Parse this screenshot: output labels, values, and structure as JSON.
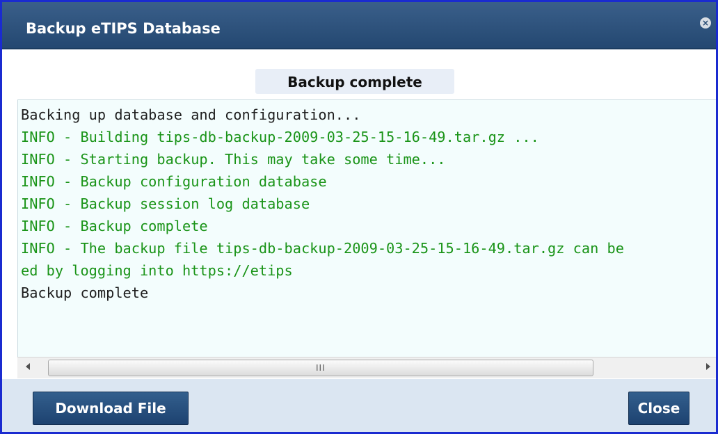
{
  "dialog": {
    "title": "Backup eTIPS Database",
    "close_icon": "close-icon",
    "status": "Backup complete"
  },
  "log": {
    "lines": [
      {
        "text": "Backing up database and configuration...",
        "type": "plain"
      },
      {
        "text": "INFO - Building tips-db-backup-2009-03-25-15-16-49.tar.gz ...",
        "type": "info"
      },
      {
        "text": "INFO - Starting backup. This may take some time...",
        "type": "info"
      },
      {
        "text": "INFO - Backup configuration database",
        "type": "info"
      },
      {
        "text": "INFO - Backup session log database",
        "type": "info"
      },
      {
        "text": "INFO - Backup complete",
        "type": "info"
      },
      {
        "text": "INFO - The backup file tips-db-backup-2009-03-25-15-16-49.tar.gz can be",
        "type": "info"
      },
      {
        "text": "ed by logging into https://etips",
        "type": "info"
      },
      {
        "text": "Backup complete",
        "type": "plain"
      }
    ],
    "colors": {
      "info": "#1a9418",
      "plain": "#1e1e1e"
    }
  },
  "scrollbar": {
    "left_icon": "scroll-left-arrow-icon",
    "right_icon": "scroll-right-arrow-icon",
    "grip": "III"
  },
  "footer": {
    "download_label": "Download File",
    "close_label": "Close"
  },
  "colors": {
    "titlebar": "#244871",
    "button": "#1d4270",
    "footer": "#dbe6f2",
    "frame": "#1a2bd0"
  }
}
